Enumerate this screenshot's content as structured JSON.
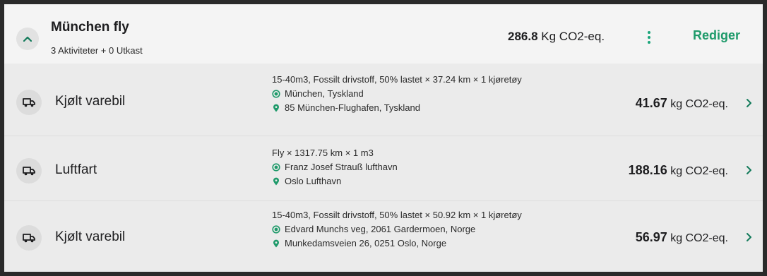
{
  "group": {
    "title": "München fly",
    "subtitle": "3 Aktiviteter + 0 Utkast",
    "total_value": "286.8",
    "total_unit": "Kg CO2-eq.",
    "edit_label": "Rediger"
  },
  "activities": [
    {
      "name": "Kjølt varebil",
      "description": "15-40m3, Fossilt drivstoff, 50% lastet × 37.24 km × 1 kjøretøy",
      "origin": "München, Tyskland",
      "destination": "85 München-Flughafen, Tyskland",
      "co2_value": "41.67",
      "co2_unit": "kg CO2-eq."
    },
    {
      "name": "Luftfart",
      "description": "Fly × 1317.75 km × 1 m3",
      "origin": "Franz Josef Strauß lufthavn",
      "destination": "Oslo Lufthavn",
      "co2_value": "188.16",
      "co2_unit": "kg CO2-eq."
    },
    {
      "name": "Kjølt varebil",
      "description": "15-40m3, Fossilt drivstoff, 50% lastet × 50.92 km × 1 kjøretøy",
      "origin": "Edvard Munchs veg, 2061 Gardermoen, Norge",
      "destination": "Munkedamsveien 26, 0251 Oslo, Norge",
      "co2_value": "56.97",
      "co2_unit": "kg CO2-eq."
    }
  ],
  "icons": {
    "collapse": "chevron-up-icon",
    "more": "more-vertical-icon",
    "truck": "truck-icon",
    "origin": "origin-dot-icon",
    "destination": "map-pin-icon",
    "row_open": "chevron-right-icon"
  },
  "colors": {
    "accent": "#1e9a6a",
    "header_bg": "#f4f4f4",
    "list_bg": "#ebebeb",
    "frame_bg": "#2a2a2a"
  }
}
